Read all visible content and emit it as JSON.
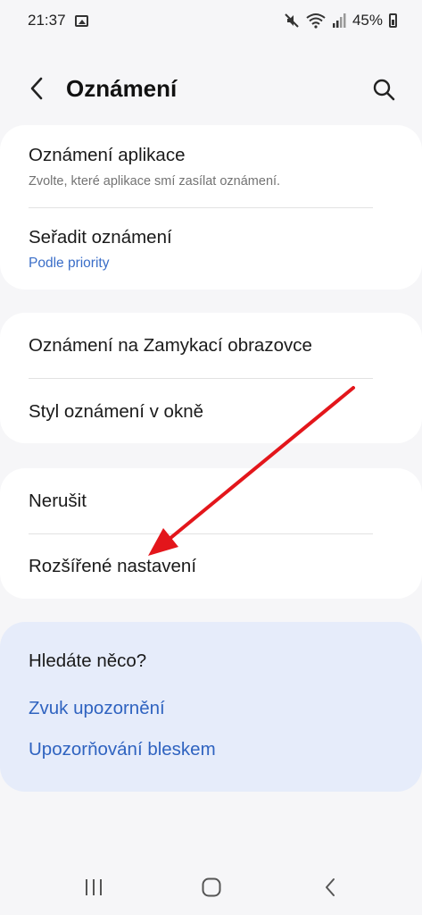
{
  "status_bar": {
    "time": "21:37",
    "battery": "45%",
    "icons": [
      "gallery-icon",
      "mute-icon",
      "wifi-icon",
      "signal-icon",
      "battery-icon"
    ]
  },
  "header": {
    "title": "Oznámení",
    "back_icon": "chevron-left-icon",
    "search_icon": "search-icon"
  },
  "groups": [
    {
      "items": [
        {
          "title": "Oznámení aplikace",
          "subtitle": "Zvolte, které aplikace smí zasílat oznámení."
        },
        {
          "title": "Seřadit oznámení",
          "subtitle": "Podle priority"
        }
      ]
    },
    {
      "items": [
        {
          "title": "Oznámení na Zamykací obrazovce"
        },
        {
          "title": "Styl oznámení v okně"
        }
      ]
    },
    {
      "items": [
        {
          "title": "Nerušit"
        },
        {
          "title": "Rozšířené nastavení"
        }
      ]
    }
  ],
  "suggestions": {
    "title": "Hledáte něco?",
    "links": [
      "Zvuk upozornění",
      "Upozorňování bleskem"
    ]
  },
  "nav_bar": {
    "icons": [
      "recent-apps-icon",
      "home-icon",
      "back-icon"
    ]
  },
  "colors": {
    "background": "#f6f6f8",
    "card": "#ffffff",
    "accent": "#3a6ec8",
    "suggestion_bg": "#e6ecfa",
    "annotation_arrow": "#e3161b"
  }
}
